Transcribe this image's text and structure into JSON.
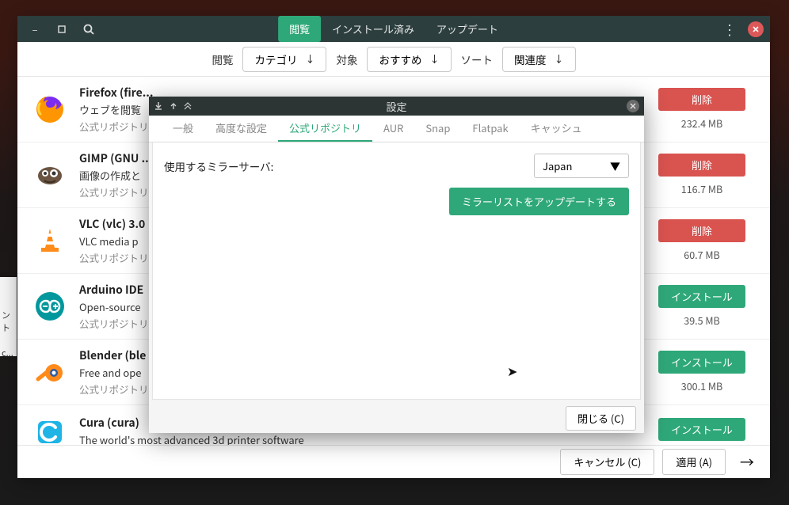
{
  "header": {
    "tabs": {
      "browse": "閲覧",
      "installed": "インストール済み",
      "updates": "アップデート"
    }
  },
  "filter": {
    "browse_label": "閲覧",
    "category": "カテゴリ",
    "target_label": "対象",
    "target_value": "おすすめ",
    "sort_label": "ソート",
    "sort_value": "関連度"
  },
  "apps": [
    {
      "icon": "firefox",
      "name": "Firefox (fire...",
      "desc": "ウェブを閲覧",
      "source": "公式リポジトリ",
      "action": "remove",
      "action_label": "削除",
      "size": "232.4 MB"
    },
    {
      "icon": "gimp",
      "name": "GIMP (GNU ...",
      "desc": "画像の作成と",
      "source": "公式リポジトリ",
      "action": "remove",
      "action_label": "削除",
      "size": "116.7 MB"
    },
    {
      "icon": "vlc",
      "name": "VLC (vlc)  3.0",
      "desc": "VLC media p",
      "source": "公式リポジトリ",
      "action": "remove",
      "action_label": "削除",
      "size": "60.7 MB"
    },
    {
      "icon": "arduino",
      "name": "Arduino IDE",
      "desc": "Open-source",
      "source": "公式リポジトリ",
      "action": "install",
      "action_label": "インストール",
      "size": "39.5 MB"
    },
    {
      "icon": "blender",
      "name": "Blender (ble",
      "desc": "Free and ope",
      "source": "公式リポジトリ",
      "action": "install",
      "action_label": "インストール",
      "size": "300.1 MB"
    },
    {
      "icon": "cura",
      "name": "Cura (cura)",
      "desc": "The world's most advanced 3d printer software",
      "source": "",
      "action": "install",
      "action_label": "インストール",
      "size": ""
    }
  ],
  "footer": {
    "cancel": "キャンセル (C)",
    "apply": "適用 (A)"
  },
  "dialog": {
    "title": "設定",
    "tabs": {
      "general": "一般",
      "advanced": "高度な設定",
      "official": "公式リポジトリ",
      "aur": "AUR",
      "snap": "Snap",
      "flatpak": "Flatpak",
      "cache": "キャッシュ"
    },
    "mirror_label": "使用するミラーサーバ:",
    "mirror_value": "Japan",
    "update_btn": "ミラーリストをアップデートする",
    "close_btn": "閉じる (C)"
  },
  "left_edge": "ント\n\nc..."
}
